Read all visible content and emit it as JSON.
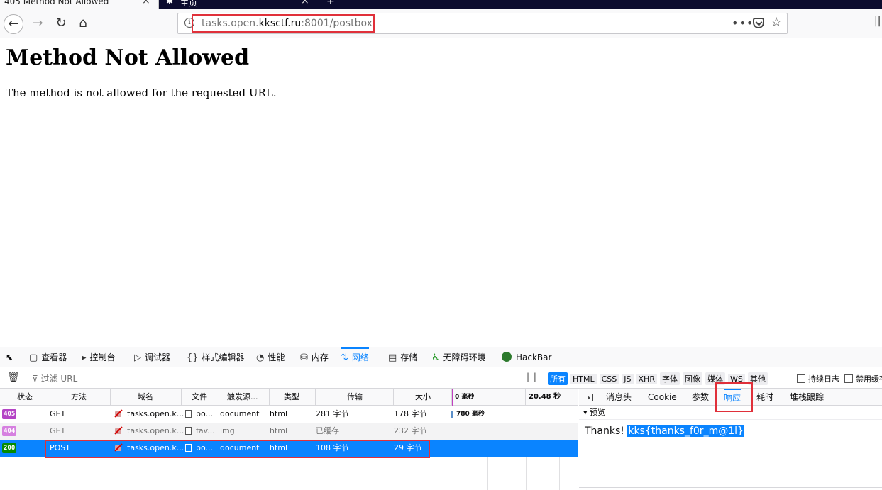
{
  "browser": {
    "tabs": [
      {
        "title": "405 Method Not Allowed",
        "active": true
      },
      {
        "title": "主页",
        "active": false
      }
    ],
    "url": {
      "prefix": "tasks.open.",
      "domain": "kksctf.ru",
      "suffix": ":8001/postbox"
    },
    "icons": [
      "back-icon",
      "forward-icon",
      "reload-icon",
      "home-icon",
      "info-icon",
      "page-actions-icon",
      "pocket-icon",
      "bookmark-star-icon",
      "library-icon"
    ]
  },
  "page": {
    "heading": "Method Not Allowed",
    "message": "The method is not allowed for the requested URL."
  },
  "devtools": {
    "tools": [
      {
        "label": "查看器",
        "icon": "⬚"
      },
      {
        "label": "控制台",
        "icon": "▸"
      },
      {
        "label": "调试器",
        "icon": "▷"
      },
      {
        "label": "样式编辑器",
        "icon": "{}"
      },
      {
        "label": "性能",
        "icon": "◔"
      },
      {
        "label": "内存",
        "icon": "⛁"
      },
      {
        "label": "网络",
        "icon": "⇅"
      },
      {
        "label": "存储",
        "icon": "▤"
      },
      {
        "label": "无障碍环境",
        "icon": "♿"
      },
      {
        "label": "HackBar",
        "icon": "●"
      }
    ],
    "filter_placeholder": "过滤 URL",
    "type_filters": [
      "所有",
      "HTML",
      "CSS",
      "JS",
      "XHR",
      "字体",
      "图像",
      "媒体",
      "WS",
      "其他"
    ],
    "checkboxes": [
      "持续日志",
      "禁用缓存"
    ],
    "columns": [
      "状态",
      "方法",
      "域名",
      "文件",
      "触发源...",
      "类型",
      "传输",
      "大小"
    ],
    "waterfall_ticks": [
      "0 毫秒",
      "20.48 秒"
    ],
    "requests": [
      {
        "status": "405",
        "method": "GET",
        "domain": "tasks.open.k...",
        "file": "po...",
        "cause": "document",
        "type": "html",
        "transferred": "281 字节",
        "size": "178 字节",
        "timing": "780 毫秒"
      },
      {
        "status": "404",
        "method": "GET",
        "domain": "tasks.open.k...",
        "file": "fav...",
        "cause": "img",
        "type": "html",
        "transferred": "已缓存",
        "size": "232 字节",
        "timing": ""
      },
      {
        "status": "200",
        "method": "POST",
        "domain": "tasks.open.k...",
        "file": "po...",
        "cause": "document",
        "type": "html",
        "transferred": "108 字节",
        "size": "29 字节",
        "timing": ""
      }
    ],
    "side_tabs": [
      "消息头",
      "Cookie",
      "参数",
      "响应",
      "耗时",
      "堆栈跟踪"
    ],
    "preview_label": "预览",
    "response_text": "Thanks! ",
    "response_flag": "kks{thanks_f0r_m@1l}",
    "colors": {
      "accent": "#0a84ff",
      "highlight": "#e0303a",
      "status_405": "#b443c5",
      "status_200": "#058b00"
    }
  }
}
